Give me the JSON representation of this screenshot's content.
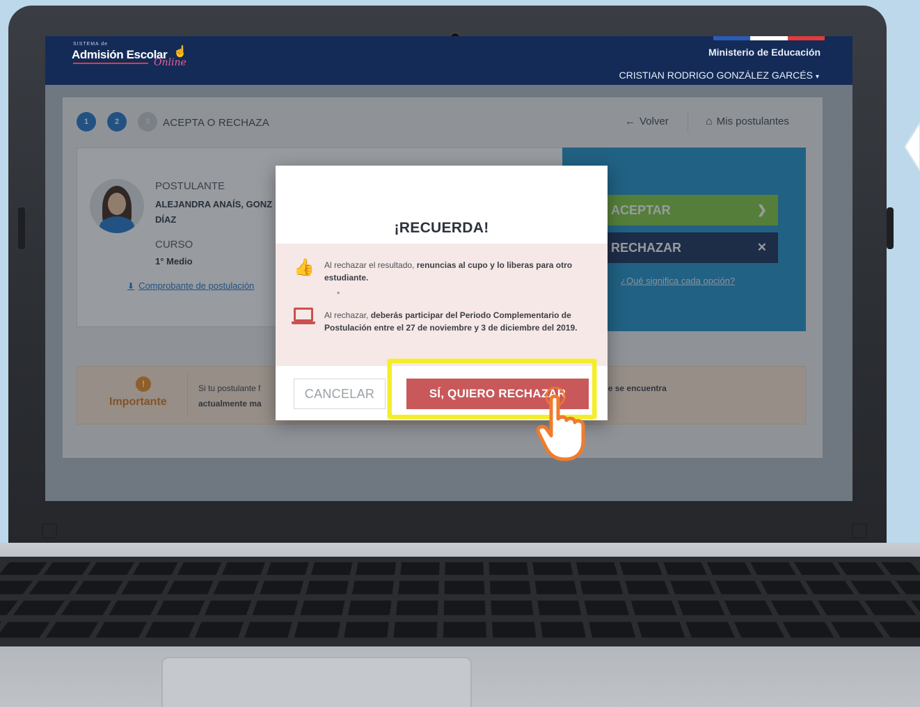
{
  "header": {
    "logo_small": "SISTEMA de",
    "logo_main": "Admisión Escolar",
    "logo_script": "Online",
    "ministry": "Ministerio de Educación",
    "user_name": "CRISTIAN RODRIGO GONZÁLEZ GARCÉS",
    "flag_colors": [
      "#2a5cb8",
      "#ffffff",
      "#e23b3b"
    ]
  },
  "stepper": {
    "steps": [
      "1",
      "2",
      "3"
    ],
    "current_label": "ACEPTA O RECHAZA"
  },
  "nav": {
    "back_label": "Volver",
    "home_label": "Mis postulantes"
  },
  "applicant": {
    "label": "POSTULANTE",
    "name_line1": "ALEJANDRA ANAÍS, GONZ",
    "name_line2": "DÍAZ",
    "course_label": "CURSO",
    "course_value": "1° Medio",
    "receipt_link": "Comprobante de postulación"
  },
  "actions": {
    "accept_label": "ACEPTAR",
    "reject_label": "RECHAZAR",
    "meaning_link": "¿Qué significa cada opción?"
  },
  "important": {
    "title": "Importante",
    "text_line1": "Si tu postulante f",
    "text_line1_bold": "nto en el que se encuentra",
    "text_line2_bold": "actualmente ma"
  },
  "modal": {
    "title": "¡RECUERDA!",
    "item1_prefix": "Al rechazar el resultado, ",
    "item1_bold": "renuncias al cupo y lo liberas para otro estudiante.",
    "item1_dot": "•",
    "item2_prefix": "Al rechazar, ",
    "item2_bold": "deberás participar del Periodo Complementario de Postulación entre el 27 de noviembre y 3 de diciembre del 2019.",
    "cancel_label": "CANCELAR",
    "confirm_label": "SÍ, QUIERO RECHAZAR"
  },
  "colors": {
    "header_navy": "#142b57",
    "accept_green": "#7ec73c",
    "reject_navy": "#142b57",
    "confirm_red": "#c9585a",
    "highlight_yellow": "#f4ee2a",
    "hand_orange": "#f07b2c"
  }
}
